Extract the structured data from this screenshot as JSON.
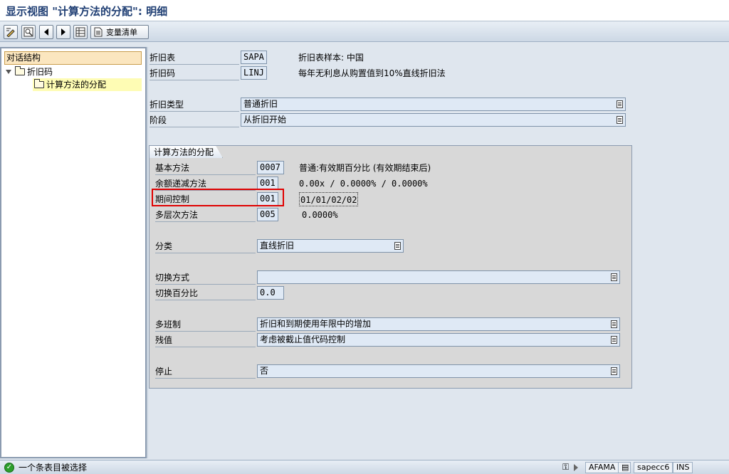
{
  "window": {
    "title": "显示视图 \"计算方法的分配\": 明细"
  },
  "toolbar": {
    "change_list_label": "变量清单"
  },
  "tree": {
    "header": "对话结构",
    "items": [
      {
        "label": "折旧码"
      },
      {
        "label": "计算方法的分配"
      }
    ]
  },
  "form": {
    "depr_table": {
      "label": "折旧表",
      "value": "SAPA",
      "desc": "折旧表样本: 中国"
    },
    "depr_key": {
      "label": "折旧码",
      "value": "LINJ",
      "desc": "每年无利息从购置值到10%直线折旧法"
    },
    "depr_type": {
      "label": "折旧类型",
      "value": "普通折旧"
    },
    "phase": {
      "label": "阶段",
      "value": "从折旧开始"
    }
  },
  "group": {
    "title": "计算方法的分配",
    "base_method": {
      "label": "基本方法",
      "value": "0007",
      "desc": "普通:有效期百分比 (有效期结束后)"
    },
    "declining": {
      "label": "余额递减方法",
      "value": "001",
      "desc": "0.00x / 0.0000% / 0.0000%"
    },
    "period_control": {
      "label": "期间控制",
      "value": "001",
      "desc": "01/01/02/02"
    },
    "multilevel": {
      "label": "多层次方法",
      "value": "005",
      "desc": "0.0000%"
    },
    "class": {
      "label": "分类",
      "value": "直线折旧"
    },
    "change_method": {
      "label": "切换方式",
      "value": ""
    },
    "change_pct": {
      "label": "切换百分比",
      "value": "0.0"
    },
    "multishift": {
      "label": "多班制",
      "value": "折旧和到期使用年限中的增加"
    },
    "scrap": {
      "label": "残值",
      "value": "考虑被截止值代码控制"
    },
    "stop": {
      "label": "停止",
      "value": "否"
    }
  },
  "status": {
    "message": "一个条表目被选择",
    "tcode": "AFAMA",
    "server": "sapecc6",
    "mode": "INS"
  },
  "colors": {
    "highlight": "#e00000",
    "accent": "#1f3e73"
  }
}
